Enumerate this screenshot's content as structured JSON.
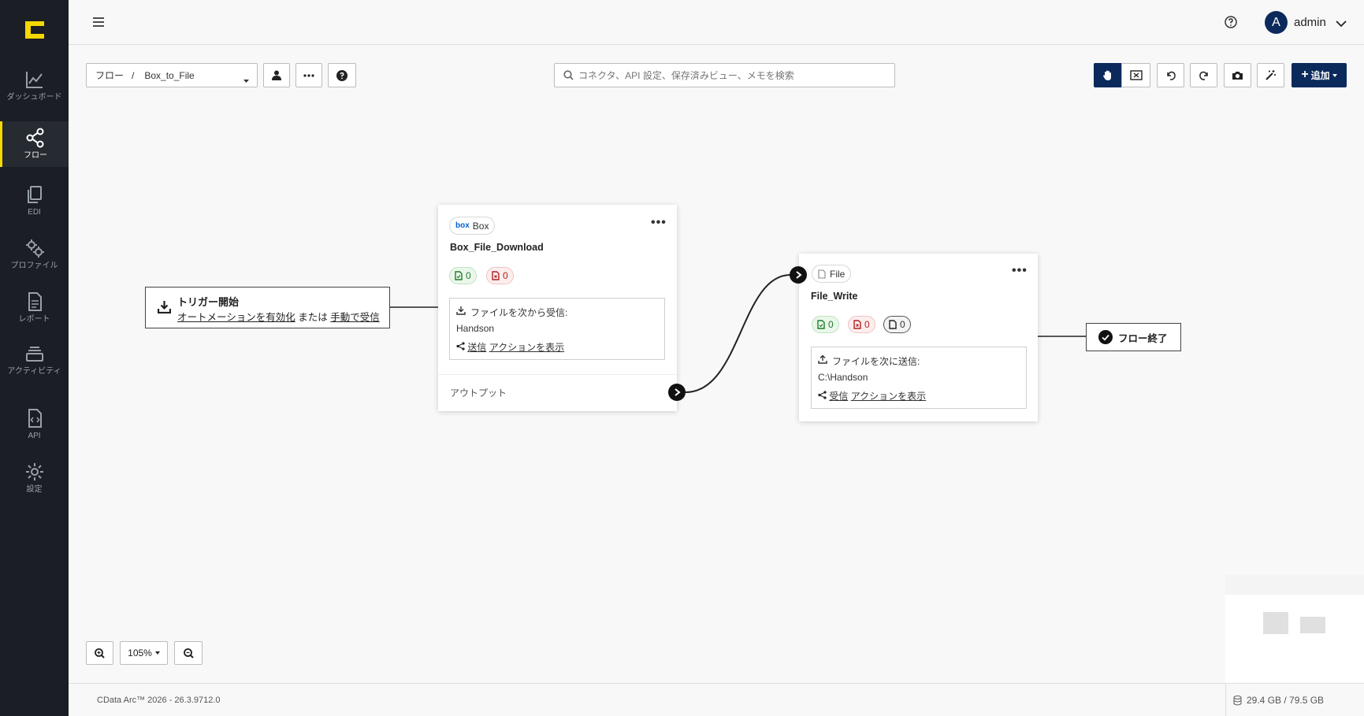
{
  "header": {
    "user_initial": "A",
    "user_name": "admin"
  },
  "sidebar": {
    "items": [
      {
        "label": "ダッシュボード",
        "icon": "chart-line-icon"
      },
      {
        "label": "フロー",
        "icon": "share-nodes-icon",
        "active": true
      },
      {
        "label": "EDI",
        "icon": "copy-icon"
      },
      {
        "label": "プロファイル",
        "icon": "gears-icon"
      },
      {
        "label": "レポート",
        "icon": "document-icon"
      },
      {
        "label": "アクティビティ",
        "icon": "layers-icon"
      },
      {
        "label": "API",
        "icon": "file-code-icon"
      },
      {
        "label": "設定",
        "icon": "gear-icon"
      }
    ]
  },
  "toolbar": {
    "breadcrumb_root": "フロー",
    "breadcrumb_sep": "/",
    "flow_name": "Box_to_File",
    "search_placeholder": "コネクタ、API 設定、保存済みビュー、メモを検索",
    "add_label": "追加"
  },
  "canvas": {
    "trigger": {
      "title": "トリガー開始",
      "line_part1": "オートメーションを有効化",
      "line_or": "または",
      "line_part2": "手動で受信"
    },
    "box_node": {
      "connector": "Box",
      "connector_logo": "box",
      "name": "Box_File_Download",
      "success_count": "0",
      "error_count": "0",
      "receive_label": "ファイルを次から受信:",
      "receive_value": "Handson",
      "action_link1": "送信",
      "action_link2": "アクションを表示",
      "output_label": "アウトプット"
    },
    "file_node": {
      "connector": "File",
      "name": "File_Write",
      "success_count": "0",
      "error_count": "0",
      "pending_count": "0",
      "send_label": "ファイルを次に送信:",
      "send_value": "C:\\Handson",
      "action_link1": "受信",
      "action_link2": "アクションを表示"
    },
    "end": {
      "label": "フロー終了"
    }
  },
  "zoom": {
    "level": "105%"
  },
  "footer": {
    "version": "CData Arc™ 2026 - 26.3.9712.0",
    "storage": "29.4 GB / 79.5 GB"
  },
  "colors": {
    "sidebar_bg": "#1b1e24",
    "accent": "#f5d800",
    "primary": "#0b2a5b",
    "success": "#1e7d2a",
    "error": "#b32020"
  }
}
